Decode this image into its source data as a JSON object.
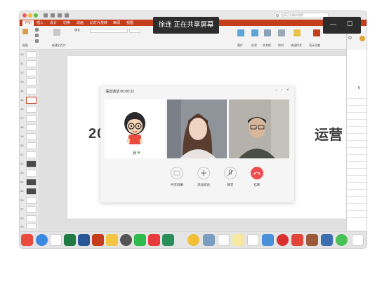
{
  "toast": {
    "text": "徐连 正在共享屏幕"
  },
  "window_controls": {
    "minimize": "—",
    "maximize": "☐"
  },
  "app": {
    "tabs": [
      "开始",
      "插入",
      "设计",
      "切换",
      "动画",
      "幻灯片放映",
      "审阅",
      "视图"
    ],
    "active_tab": "开始",
    "search_placeholder": "在演示文稿中搜索"
  },
  "ribbon": {
    "paste": "粘贴",
    "new_slide": "新建幻灯片",
    "layout": "版式",
    "groups": [
      "图片",
      "形状",
      "文本框",
      "排列",
      "快速样式",
      "设计灵感"
    ]
  },
  "slides": [
    "10",
    "11",
    "12",
    "13",
    "14",
    "15",
    "16",
    "17",
    "18",
    "19",
    "20",
    "21",
    "22",
    "23",
    "24",
    "25",
    "26",
    "27",
    "28",
    "29"
  ],
  "selected_slide": "15",
  "slide": {
    "title_left": "2020",
    "title_right": "运营"
  },
  "excel": {
    "cell_label": "K",
    "tab_label": "中"
  },
  "call": {
    "title": "语音通话 00:00:32",
    "me_label": "我",
    "buttons": [
      {
        "label": "共享屏幕"
      },
      {
        "label": "添加成员"
      },
      {
        "label": "静音"
      },
      {
        "label": "挂断"
      }
    ]
  },
  "dock": {
    "apps": [
      "finder-app",
      "safari-app",
      "chrome-app",
      "excel-app",
      "word-app",
      "powerpoint-app",
      "notes-app",
      "system-app",
      "wechat-app",
      "video-app",
      "maps-app",
      "chrome2-app",
      "preview-app",
      "calendar-app",
      "stickies-app",
      "reminders-app",
      "pencil-app",
      "netease-app",
      "stocks-app",
      "photos-app",
      "keynote-app",
      "messages-app",
      "wechat2-app"
    ]
  },
  "colors": {
    "accent": "#c43e1c",
    "hangup": "#ee4d4d",
    "toast_bg": "#2c2c2c"
  }
}
